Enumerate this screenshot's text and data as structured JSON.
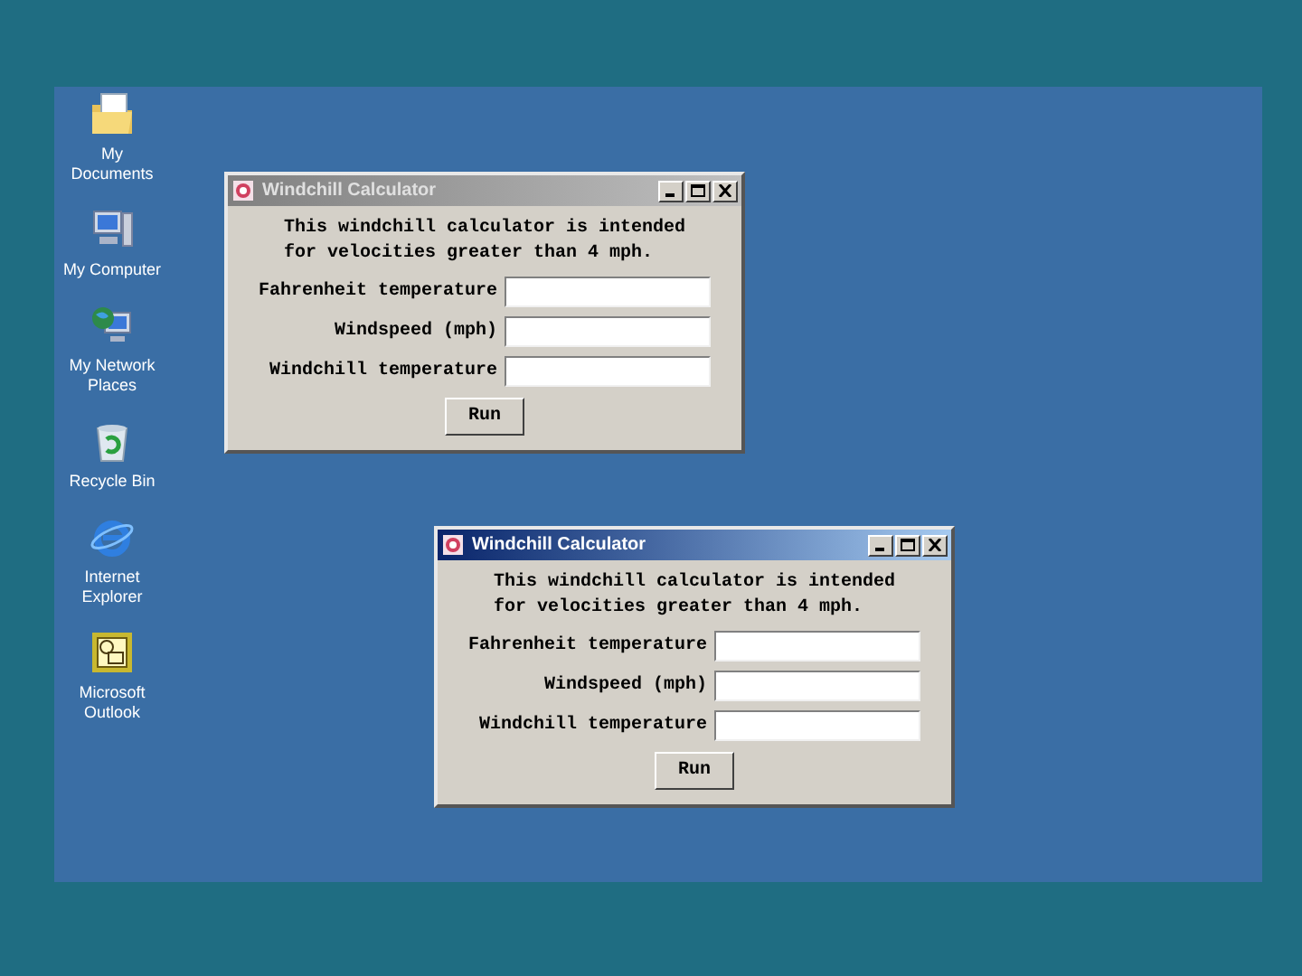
{
  "desktop_icons": [
    {
      "kind": "documents",
      "label": "My Documents"
    },
    {
      "kind": "computer",
      "label": "My Computer"
    },
    {
      "kind": "network",
      "label": "My Network Places"
    },
    {
      "kind": "recycle",
      "label": "Recycle Bin"
    },
    {
      "kind": "browser",
      "label": "Internet Explorer"
    },
    {
      "kind": "mail",
      "label": "Microsoft Outlook"
    }
  ],
  "windows": [
    {
      "title": "Windchill Calculator",
      "active": false,
      "message": [
        "This windchill calculator is intended",
        "for velocities greater than 4 mph."
      ],
      "fields": [
        {
          "label": "Fahrenheit temperature"
        },
        {
          "label": "Windspeed (mph)"
        },
        {
          "label": "Windchill temperature"
        }
      ],
      "button": "Run"
    },
    {
      "title": "Windchill Calculator",
      "active": true,
      "message": [
        "This windchill calculator is intended",
        "for velocities greater than 4 mph."
      ],
      "fields": [
        {
          "label": "Fahrenheit temperature"
        },
        {
          "label": "Windspeed (mph)"
        },
        {
          "label": "Windchill temperature"
        }
      ],
      "button": "Run"
    }
  ]
}
